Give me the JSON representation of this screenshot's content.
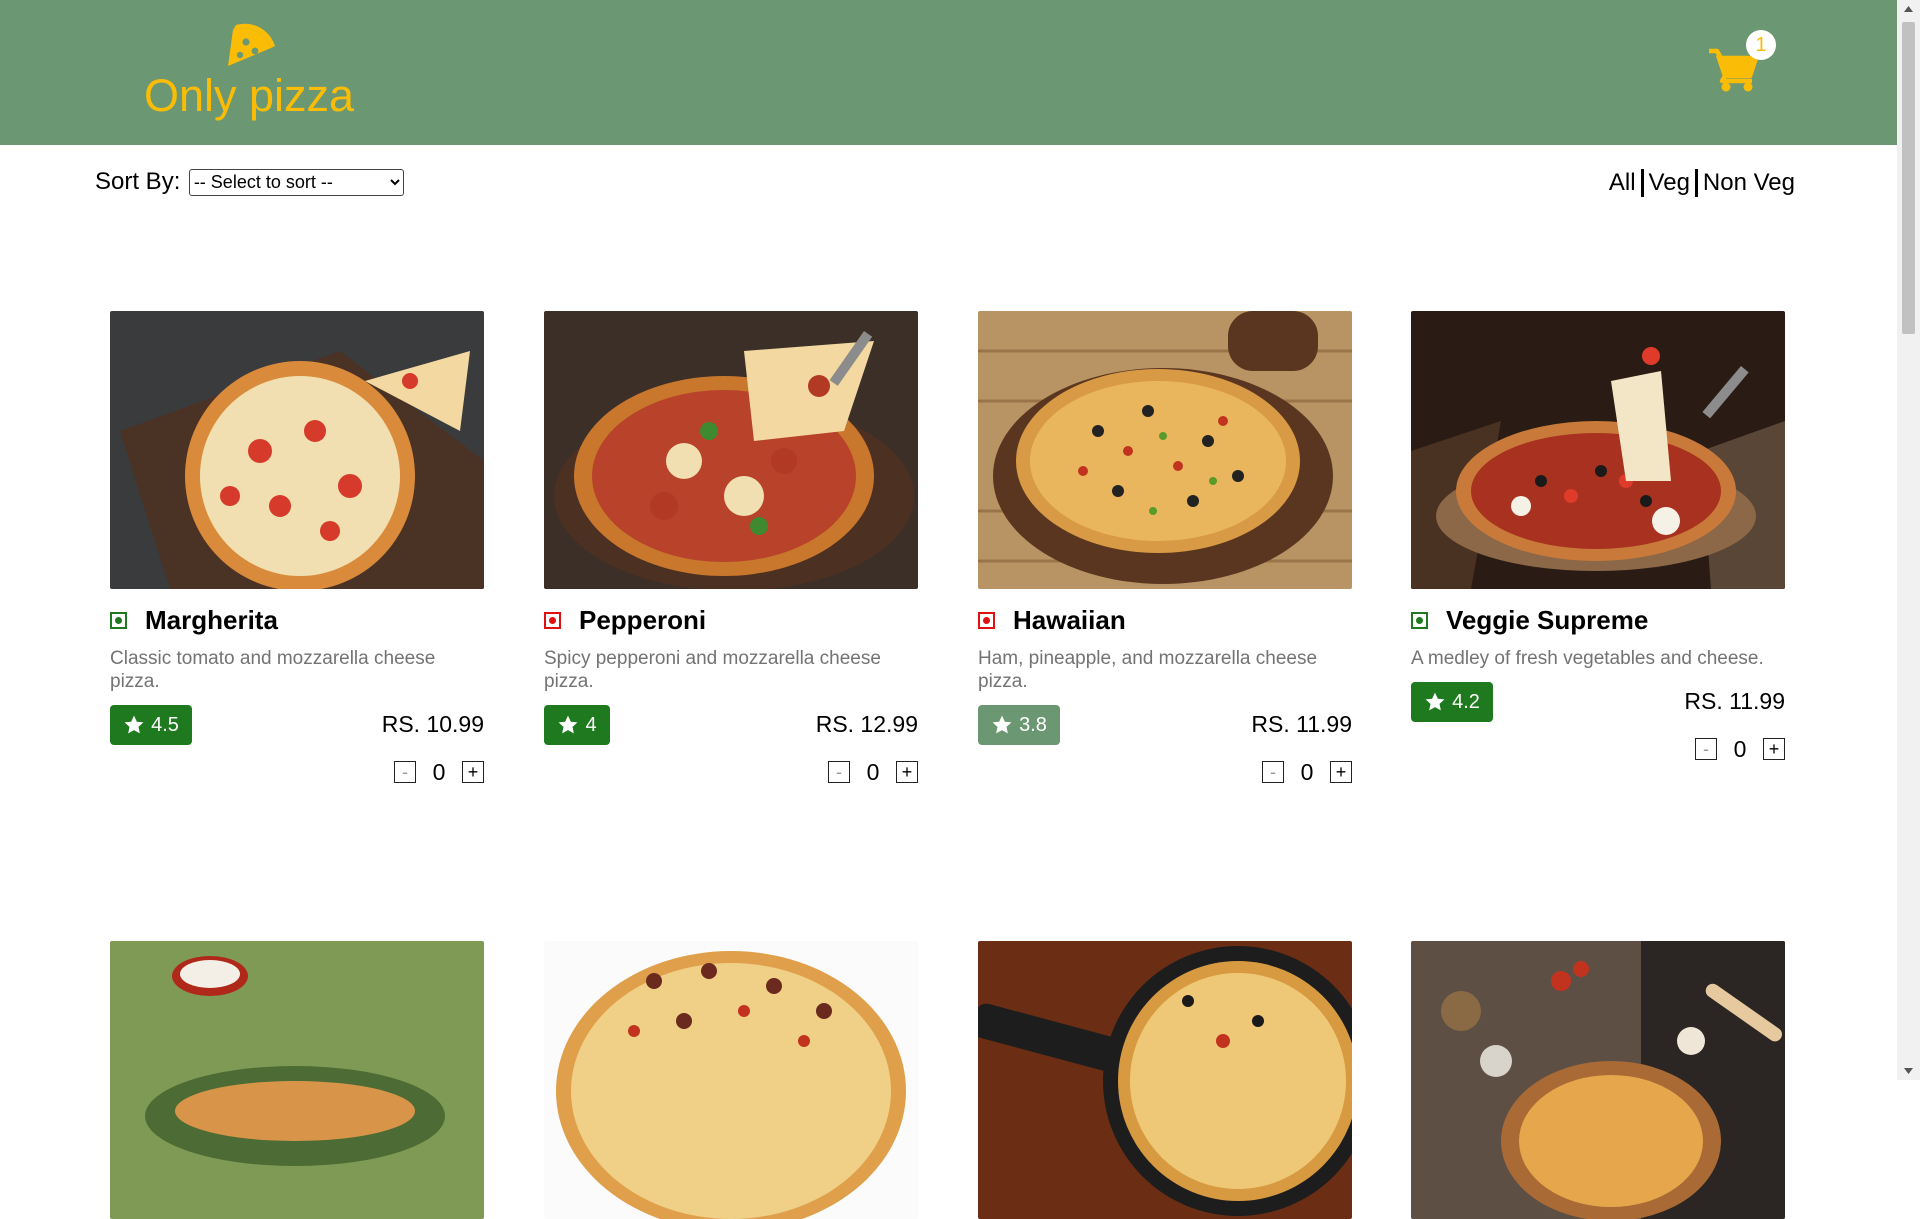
{
  "header": {
    "logo_text": "Only pizza",
    "brand_color": "#fbbc05",
    "header_bg": "#6b9873",
    "cart_count": "1"
  },
  "toolbar": {
    "sort_label": "Sort By:",
    "sort_selected": "-- Select to sort --",
    "filters": [
      "All",
      "Veg",
      "Non Veg"
    ]
  },
  "products": [
    {
      "name": "Margherita",
      "type": "veg",
      "description": "Classic tomato and mozzarella cheese pizza.",
      "rating": "4.5",
      "price": "RS. 10.99",
      "qty": "0"
    },
    {
      "name": "Pepperoni",
      "type": "non-veg",
      "description": "Spicy pepperoni and mozzarella cheese pizza.",
      "rating": "4",
      "price": "RS. 12.99",
      "qty": "0"
    },
    {
      "name": "Hawaiian",
      "type": "non-veg",
      "description": "Ham, pineapple, and mozzarella cheese pizza.",
      "rating": "3.8",
      "price": "RS. 11.99",
      "qty": "0"
    },
    {
      "name": "Veggie Supreme",
      "type": "veg",
      "description": "A medley of fresh vegetables and cheese.",
      "rating": "4.2",
      "price": "RS. 11.99",
      "qty": "0"
    }
  ],
  "icons": {
    "logo": "pizza-slice-icon",
    "cart": "shopping-cart-icon",
    "rating": "star-icon",
    "veg": "veg-indicator-icon",
    "nonveg": "nonveg-indicator-icon"
  },
  "colors": {
    "veg": "#1f7a1f",
    "nonveg": "#dd1111",
    "rating_high": "#1f7a1f",
    "rating_mid": "#6b9873"
  }
}
